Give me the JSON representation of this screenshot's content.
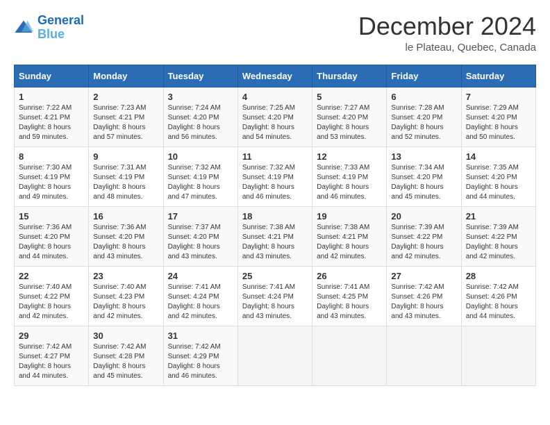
{
  "header": {
    "logo_line1": "General",
    "logo_line2": "Blue",
    "month": "December 2024",
    "location": "le Plateau, Quebec, Canada"
  },
  "days_of_week": [
    "Sunday",
    "Monday",
    "Tuesday",
    "Wednesday",
    "Thursday",
    "Friday",
    "Saturday"
  ],
  "weeks": [
    [
      {
        "day": 1,
        "sunrise": "7:22 AM",
        "sunset": "4:21 PM",
        "daylight": "8 hours and 59 minutes."
      },
      {
        "day": 2,
        "sunrise": "7:23 AM",
        "sunset": "4:21 PM",
        "daylight": "8 hours and 57 minutes."
      },
      {
        "day": 3,
        "sunrise": "7:24 AM",
        "sunset": "4:20 PM",
        "daylight": "8 hours and 56 minutes."
      },
      {
        "day": 4,
        "sunrise": "7:25 AM",
        "sunset": "4:20 PM",
        "daylight": "8 hours and 54 minutes."
      },
      {
        "day": 5,
        "sunrise": "7:27 AM",
        "sunset": "4:20 PM",
        "daylight": "8 hours and 53 minutes."
      },
      {
        "day": 6,
        "sunrise": "7:28 AM",
        "sunset": "4:20 PM",
        "daylight": "8 hours and 52 minutes."
      },
      {
        "day": 7,
        "sunrise": "7:29 AM",
        "sunset": "4:20 PM",
        "daylight": "8 hours and 50 minutes."
      }
    ],
    [
      {
        "day": 8,
        "sunrise": "7:30 AM",
        "sunset": "4:19 PM",
        "daylight": "8 hours and 49 minutes."
      },
      {
        "day": 9,
        "sunrise": "7:31 AM",
        "sunset": "4:19 PM",
        "daylight": "8 hours and 48 minutes."
      },
      {
        "day": 10,
        "sunrise": "7:32 AM",
        "sunset": "4:19 PM",
        "daylight": "8 hours and 47 minutes."
      },
      {
        "day": 11,
        "sunrise": "7:32 AM",
        "sunset": "4:19 PM",
        "daylight": "8 hours and 46 minutes."
      },
      {
        "day": 12,
        "sunrise": "7:33 AM",
        "sunset": "4:19 PM",
        "daylight": "8 hours and 46 minutes."
      },
      {
        "day": 13,
        "sunrise": "7:34 AM",
        "sunset": "4:20 PM",
        "daylight": "8 hours and 45 minutes."
      },
      {
        "day": 14,
        "sunrise": "7:35 AM",
        "sunset": "4:20 PM",
        "daylight": "8 hours and 44 minutes."
      }
    ],
    [
      {
        "day": 15,
        "sunrise": "7:36 AM",
        "sunset": "4:20 PM",
        "daylight": "8 hours and 44 minutes."
      },
      {
        "day": 16,
        "sunrise": "7:36 AM",
        "sunset": "4:20 PM",
        "daylight": "8 hours and 43 minutes."
      },
      {
        "day": 17,
        "sunrise": "7:37 AM",
        "sunset": "4:20 PM",
        "daylight": "8 hours and 43 minutes."
      },
      {
        "day": 18,
        "sunrise": "7:38 AM",
        "sunset": "4:21 PM",
        "daylight": "8 hours and 43 minutes."
      },
      {
        "day": 19,
        "sunrise": "7:38 AM",
        "sunset": "4:21 PM",
        "daylight": "8 hours and 42 minutes."
      },
      {
        "day": 20,
        "sunrise": "7:39 AM",
        "sunset": "4:22 PM",
        "daylight": "8 hours and 42 minutes."
      },
      {
        "day": 21,
        "sunrise": "7:39 AM",
        "sunset": "4:22 PM",
        "daylight": "8 hours and 42 minutes."
      }
    ],
    [
      {
        "day": 22,
        "sunrise": "7:40 AM",
        "sunset": "4:22 PM",
        "daylight": "8 hours and 42 minutes."
      },
      {
        "day": 23,
        "sunrise": "7:40 AM",
        "sunset": "4:23 PM",
        "daylight": "8 hours and 42 minutes."
      },
      {
        "day": 24,
        "sunrise": "7:41 AM",
        "sunset": "4:24 PM",
        "daylight": "8 hours and 42 minutes."
      },
      {
        "day": 25,
        "sunrise": "7:41 AM",
        "sunset": "4:24 PM",
        "daylight": "8 hours and 43 minutes."
      },
      {
        "day": 26,
        "sunrise": "7:41 AM",
        "sunset": "4:25 PM",
        "daylight": "8 hours and 43 minutes."
      },
      {
        "day": 27,
        "sunrise": "7:42 AM",
        "sunset": "4:26 PM",
        "daylight": "8 hours and 43 minutes."
      },
      {
        "day": 28,
        "sunrise": "7:42 AM",
        "sunset": "4:26 PM",
        "daylight": "8 hours and 44 minutes."
      }
    ],
    [
      {
        "day": 29,
        "sunrise": "7:42 AM",
        "sunset": "4:27 PM",
        "daylight": "8 hours and 44 minutes."
      },
      {
        "day": 30,
        "sunrise": "7:42 AM",
        "sunset": "4:28 PM",
        "daylight": "8 hours and 45 minutes."
      },
      {
        "day": 31,
        "sunrise": "7:42 AM",
        "sunset": "4:29 PM",
        "daylight": "8 hours and 46 minutes."
      },
      null,
      null,
      null,
      null
    ]
  ]
}
